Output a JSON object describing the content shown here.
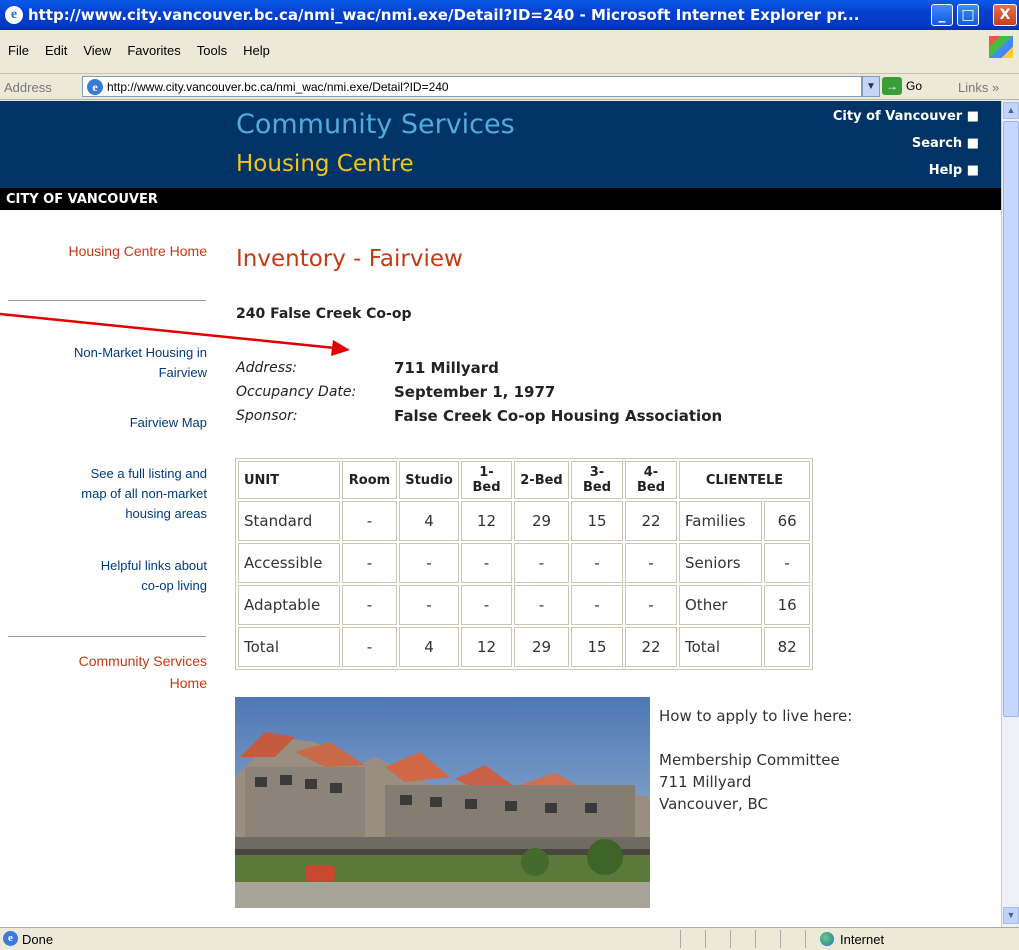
{
  "window": {
    "title": "http://www.city.vancouver.bc.ca/nmi_wac/nmi.exe/Detail?ID=240 - Microsoft Internet Explorer pr...",
    "minimize": "_",
    "maximize": "□",
    "close": "X"
  },
  "menu": [
    "File",
    "Edit",
    "View",
    "Favorites",
    "Tools",
    "Help"
  ],
  "address": {
    "label": "Address",
    "url": "http://www.city.vancouver.bc.ca/nmi_wac/nmi.exe/Detail?ID=240",
    "go": "Go",
    "links": "Links"
  },
  "header": {
    "title": "Community Services",
    "subtitle": "Housing Centre",
    "links": [
      "City of Vancouver ■",
      "Search ■",
      "Help ■"
    ],
    "bar": "CITY OF VANCOUVER"
  },
  "sidebar": {
    "home": "Housing Centre Home",
    "nonmarket": [
      "Non-Market Housing in",
      "Fairview"
    ],
    "map": "Fairview Map",
    "listing": [
      "See a full listing and",
      "map of all non-market",
      "housing areas"
    ],
    "helpful": [
      "Helpful links about",
      "co-op living"
    ],
    "cs_home": [
      "Community Services",
      "Home"
    ]
  },
  "main": {
    "title": "Inventory - Fairview",
    "coop": "240 False Creek Co-op",
    "details": [
      {
        "label": "Address:",
        "value": "711 Millyard"
      },
      {
        "label": "Occupancy Date:",
        "value": "September 1, 1977"
      },
      {
        "label": "Sponsor:",
        "value": "False Creek Co-op Housing Association"
      }
    ]
  },
  "table": {
    "headers": [
      "UNIT",
      "Room",
      "Studio",
      "1-Bed",
      "2-Bed",
      "3-Bed",
      "4-Bed",
      "CLIENTELE"
    ],
    "rows": [
      [
        "Standard",
        "-",
        "4",
        "12",
        "29",
        "15",
        "22",
        "Families",
        "66"
      ],
      [
        "Accessible",
        "-",
        "-",
        "-",
        "-",
        "-",
        "-",
        "Seniors",
        "-"
      ],
      [
        "Adaptable",
        "-",
        "-",
        "-",
        "-",
        "-",
        "-",
        "Other",
        "16"
      ],
      [
        "Total",
        "-",
        "4",
        "12",
        "29",
        "15",
        "22",
        "Total",
        "82"
      ]
    ]
  },
  "apply": {
    "heading": "How to apply to live here:",
    "lines": [
      "Membership Committee",
      "711 Millyard",
      "Vancouver, BC"
    ]
  },
  "status": {
    "text": "Done",
    "zone": "Internet"
  },
  "colors": {
    "header_bg": "#003366",
    "accent_red": "#c23b12",
    "accent_yellow": "#f5c518",
    "arrow_red": "#e00000"
  }
}
